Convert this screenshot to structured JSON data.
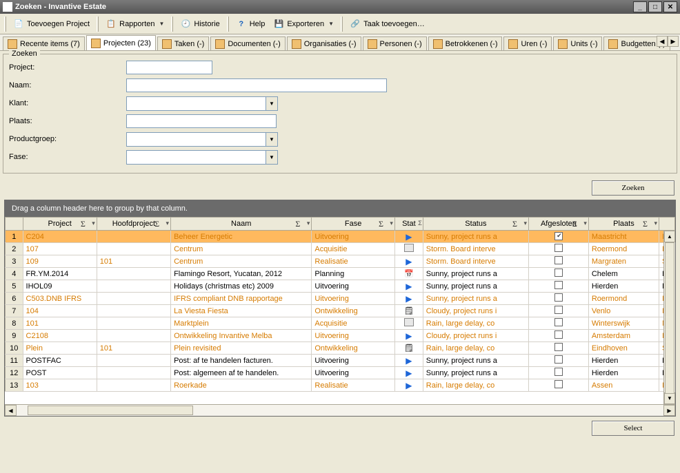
{
  "window": {
    "title": "Zoeken - Invantive Estate"
  },
  "toolbar": {
    "add_project": "Toevoegen Project",
    "reports": "Rapporten",
    "history": "Historie",
    "help": "Help",
    "export": "Exporteren",
    "add_task": "Taak toevoegen…"
  },
  "tabs": {
    "recente": "Recente items (7)",
    "projecten": "Projecten (23)",
    "taken": "Taken (-)",
    "documenten": "Documenten (-)",
    "organisaties": "Organisaties (-)",
    "personen": "Personen (-)",
    "betrokkenen": "Betrokkenen (-)",
    "uren": "Uren (-)",
    "units": "Units (-)",
    "budgetten": "Budgetten (-)"
  },
  "form": {
    "legend": "Zoeken",
    "project_label": "Project:",
    "naam_label": "Naam:",
    "klant_label": "Klant:",
    "plaats_label": "Plaats:",
    "productgroep_label": "Productgroep:",
    "fase_label": "Fase:"
  },
  "buttons": {
    "zoeken": "Zoeken",
    "select": "Select"
  },
  "grid": {
    "group_hint": "Drag a column header here to group by that column.",
    "columns": {
      "project": "Project",
      "hoofdproject": "Hoofdproject",
      "naam": "Naam",
      "fase": "Fase",
      "stat": "Stat",
      "status": "Status",
      "afgesloten": "Afgesloten",
      "plaats": "Plaats"
    },
    "rows": [
      {
        "n": "1",
        "project": "C204",
        "hoofd": "",
        "naam": "Beheer Energetic",
        "fase": "Uitvoering",
        "stat": "play",
        "status": "Sunny, project runs a",
        "afg": true,
        "plaats": "Maastricht",
        "ext": "In",
        "hl": true,
        "orange": true
      },
      {
        "n": "2",
        "project": "107",
        "hoofd": "",
        "naam": "Centrum",
        "fase": "Acquisitie",
        "stat": "doc",
        "status": "Storm. Board interve",
        "afg": false,
        "plaats": "Roermond",
        "ext": "In",
        "orange": true
      },
      {
        "n": "3",
        "project": "109",
        "hoofd": "101",
        "naam": "Centrum",
        "fase": "Realisatie",
        "stat": "play",
        "status": "Storm. Board interve",
        "afg": false,
        "plaats": "Margraten",
        "ext": "Su",
        "orange": true
      },
      {
        "n": "4",
        "project": "FR.YM.2014",
        "hoofd": "",
        "naam": "Flamingo Resort, Yucatan, 2012",
        "fase": "Planning",
        "stat": "cal",
        "status": "Sunny, project runs a",
        "afg": false,
        "plaats": "Chelem",
        "ext": "In"
      },
      {
        "n": "5",
        "project": "IHOL09",
        "hoofd": "",
        "naam": "Holidays (christmas etc) 2009",
        "fase": "Uitvoering",
        "stat": "play",
        "status": "Sunny, project runs a",
        "afg": false,
        "plaats": "Hierden",
        "ext": "In"
      },
      {
        "n": "6",
        "project": "C503.DNB IFRS",
        "hoofd": "",
        "naam": "IFRS compliant DNB rapportage",
        "fase": "Uitvoering",
        "stat": "play",
        "status": "Sunny, project runs a",
        "afg": false,
        "plaats": "Roermond",
        "ext": "In",
        "orange": true
      },
      {
        "n": "7",
        "project": "104",
        "hoofd": "",
        "naam": "La Viesta Fiesta",
        "fase": "Ontwikkeling",
        "stat": "file",
        "status": "Cloudy, project runs i",
        "afg": false,
        "plaats": "Venlo",
        "ext": "In",
        "orange": true
      },
      {
        "n": "8",
        "project": "101",
        "hoofd": "",
        "naam": "Marktplein",
        "fase": "Acquisitie",
        "stat": "doc",
        "status": "Rain, large delay, co",
        "afg": false,
        "plaats": "Winterswijk",
        "ext": "M",
        "orange": true
      },
      {
        "n": "9",
        "project": "C2108",
        "hoofd": "",
        "naam": "Ontwikkeling Invantive Melba",
        "fase": "Uitvoering",
        "stat": "play",
        "status": "Cloudy, project runs i",
        "afg": false,
        "plaats": "Amsterdam",
        "ext": "In",
        "orange": true
      },
      {
        "n": "10",
        "project": "Plein",
        "hoofd": "101",
        "naam": "Plein revisited",
        "fase": "Ontwikkeling",
        "stat": "file",
        "status": "Rain, large delay, co",
        "afg": false,
        "plaats": "Eindhoven",
        "ext": "Su",
        "orange": true
      },
      {
        "n": "11",
        "project": "POSTFAC",
        "hoofd": "",
        "naam": "Post: af te handelen facturen.",
        "fase": "Uitvoering",
        "stat": "play",
        "status": "Sunny, project runs a",
        "afg": false,
        "plaats": "Hierden",
        "ext": "In"
      },
      {
        "n": "12",
        "project": "POST",
        "hoofd": "",
        "naam": "Post: algemeen af te handelen.",
        "fase": "Uitvoering",
        "stat": "play",
        "status": "Sunny, project runs a",
        "afg": false,
        "plaats": "Hierden",
        "ext": "In"
      },
      {
        "n": "13",
        "project": "103",
        "hoofd": "",
        "naam": "Roerkade",
        "fase": "Realisatie",
        "stat": "play",
        "status": "Rain, large delay, co",
        "afg": false,
        "plaats": "Assen",
        "ext": "In",
        "orange": true
      }
    ]
  }
}
